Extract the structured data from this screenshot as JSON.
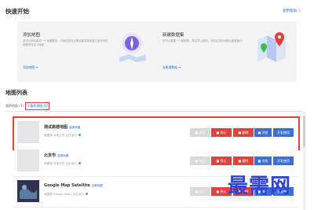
{
  "quick_start": {
    "title": "快速开始",
    "help_link": "使用帮助 ⓘ",
    "add_map": {
      "title": "添加地图",
      "desc": "您可以添加新的一个地图服务，可添加您在谷歌或者高德或其它服务商的地图来自定义地图",
      "link": "添加地图 ➔"
    },
    "create_dataset": {
      "title": "新建数据集",
      "desc": "您可以新建一个数据集，然后导入数据，添加至您的地图以数据展示",
      "link": "去新建数据 ➔"
    }
  },
  "map_list": {
    "title": "地图列表",
    "tabs": [
      {
        "label": "我的地图 (3)"
      },
      {
        "label": "下载的地图 (0)"
      }
    ],
    "rows": [
      {
        "name": "测试高德地图",
        "badge": "高德地图",
        "meta": "地图源  本地文件  正在运行",
        "buttons": [
          "■ 运行",
          "■ 停止",
          "■ 删除",
          "■ 浏览",
          "开发使用"
        ]
      },
      {
        "name": "北京市",
        "badge": "高德地图",
        "meta": "地图源  本地文件  正在运行",
        "buttons": [
          "■ 运行",
          "■ 停止",
          "■ 删除",
          "■ 浏览",
          "开发使用"
        ]
      },
      {
        "name": "Google Map Satellite",
        "badge": "谷歌地图",
        "meta": "地图源  Google Maps  正在运行",
        "buttons": [
          "■ 运行",
          "■ 停止",
          "■ 删除",
          "■ 浏览",
          "开发使用"
        ]
      }
    ]
  },
  "watermark": "最需网",
  "colors": {
    "accent_blue": "#3a6fd8",
    "danger_red": "#e0413f",
    "link_blue": "#2b6cdc",
    "status_green": "#3cba54"
  }
}
